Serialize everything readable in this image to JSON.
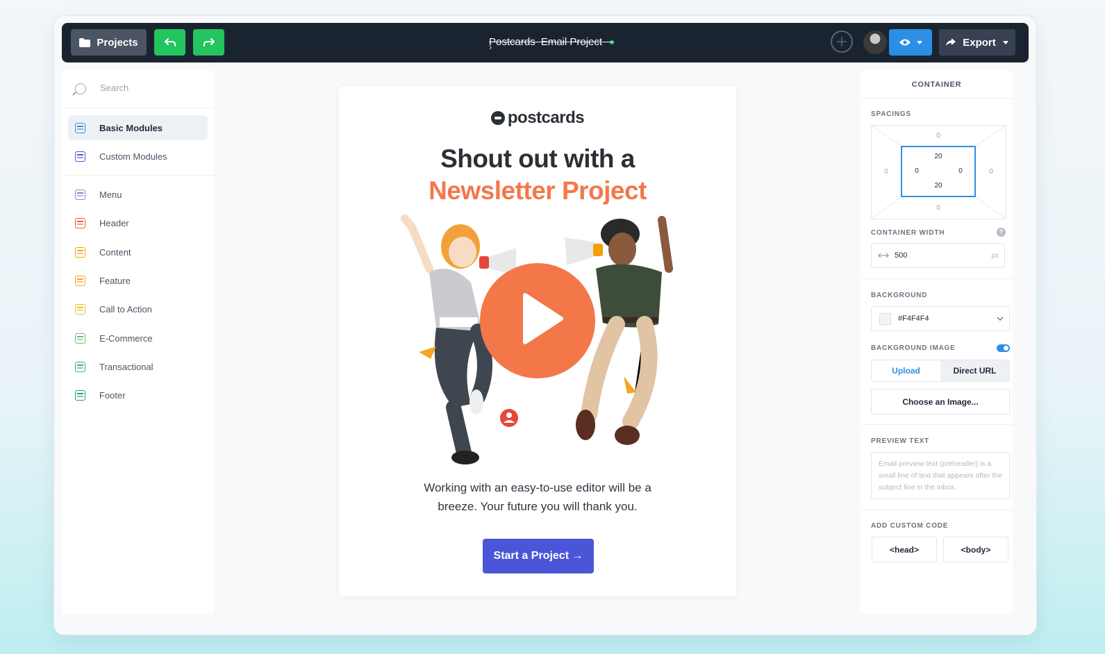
{
  "toolbar": {
    "projects_label": "Projects",
    "preview_icon": "eye-icon",
    "export_label": "Export"
  },
  "breadcrumb": {
    "parent": "Postcards",
    "current": "Email Project",
    "status_color": "#22c55e"
  },
  "sidebar": {
    "search_placeholder": "Search",
    "groups": [
      {
        "label": "Basic Modules",
        "icon": "text-a-icon",
        "color": "#2b8fe6",
        "active": true
      },
      {
        "label": "Custom Modules",
        "icon": "puzzle-icon",
        "color": "#4a55d8",
        "active": false
      }
    ],
    "items": [
      {
        "label": "Menu",
        "icon": "menu-icon",
        "color": "#8b7fd6"
      },
      {
        "label": "Header",
        "icon": "header-icon",
        "color": "#ef5a43"
      },
      {
        "label": "Content",
        "icon": "content-icon",
        "color": "#f59e0b"
      },
      {
        "label": "Feature",
        "icon": "feature-icon",
        "color": "#f5a524"
      },
      {
        "label": "Call to Action",
        "icon": "cursor-icon",
        "color": "#e0c324"
      },
      {
        "label": "E-Commerce",
        "icon": "cart-icon",
        "color": "#5cc47a"
      },
      {
        "label": "Transactional",
        "icon": "transactional-icon",
        "color": "#2fb36a"
      },
      {
        "label": "Footer",
        "icon": "footer-icon",
        "color": "#22a05a"
      }
    ]
  },
  "email": {
    "logo_text": "postcards",
    "headline_1": "Shout out with a",
    "headline_2": "Newsletter Project",
    "body": "Working with an easy-to-use editor will be a breeze. Your future you will thank you.",
    "cta_label": "Start a Project →",
    "accent_color": "#f4774a",
    "cta_color": "#4a55d8"
  },
  "panel": {
    "title": "CONTAINER",
    "spacings_label": "SPACINGS",
    "margin": {
      "top": "0",
      "right": "0",
      "bottom": "0",
      "left": "0"
    },
    "padding": {
      "top": "20",
      "right": "0",
      "bottom": "20",
      "left": "0"
    },
    "width_label": "CONTAINER WIDTH",
    "width_value": "500",
    "width_unit": "px",
    "help": "?",
    "background_label": "BACKGROUND",
    "background_value": "#F4F4F4",
    "background_image_label": "BACKGROUND IMAGE",
    "upload_label": "Upload",
    "direct_url_label": "Direct URL",
    "choose_image_label": "Choose an Image...",
    "preview_text_label": "PREVIEW TEXT",
    "preview_placeholder": "Email preview text (preheader) is a small line of text that appears after the subject line in the inbox.",
    "custom_code_label": "ADD CUSTOM CODE",
    "head_label": "<head>",
    "body_label": "<body>"
  }
}
